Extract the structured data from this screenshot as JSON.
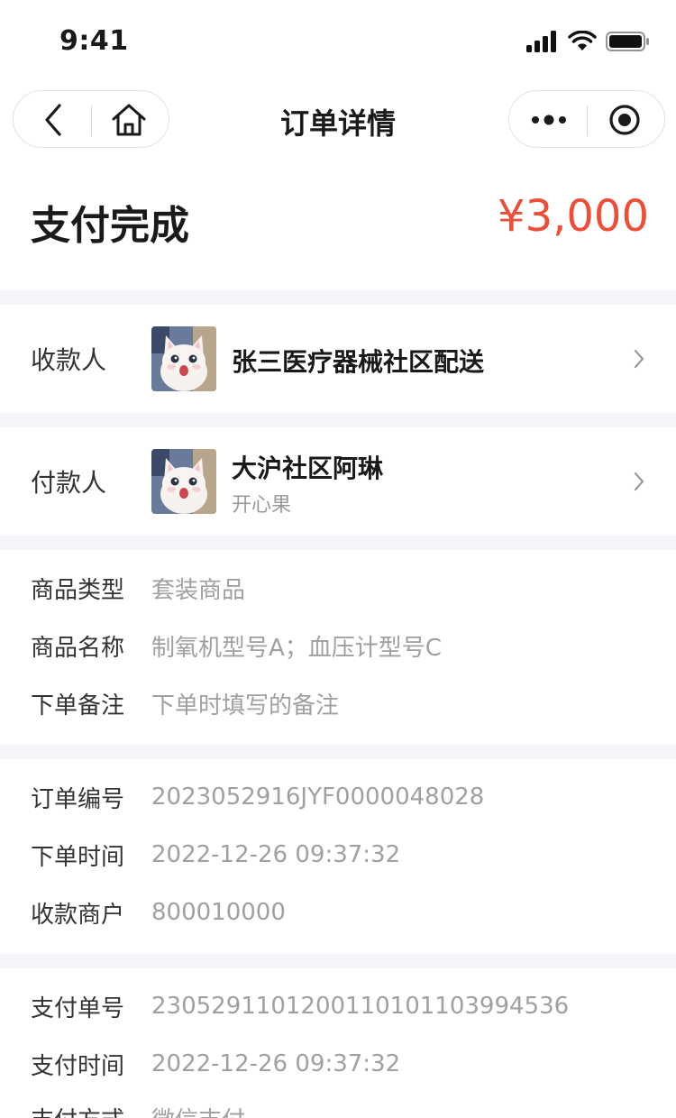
{
  "status_bar": {
    "time": "9:41"
  },
  "nav": {
    "title": "订单详情"
  },
  "header": {
    "status": "支付完成",
    "amount": "¥3,000"
  },
  "payee": {
    "label": "收款人",
    "name": "张三医疗器械社区配送"
  },
  "payer": {
    "label": "付款人",
    "name": "大沪社区阿琳",
    "sub": "开心果"
  },
  "product": [
    {
      "label": "商品类型",
      "value": "套装商品"
    },
    {
      "label": "商品名称",
      "value": "制氧机型号A；血压计型号C"
    },
    {
      "label": "下单备注",
      "value": "下单时填写的备注"
    }
  ],
  "order": [
    {
      "label": "订单编号",
      "value": "2023052916JYF0000048028"
    },
    {
      "label": "下单时间",
      "value": "2022-12-26 09:37:32"
    },
    {
      "label": "收款商户",
      "value": "800010000"
    }
  ],
  "payment": [
    {
      "label": "支付单号",
      "value": "2305291101200110101103994536"
    },
    {
      "label": "支付时间",
      "value": "2022-12-26 09:37:32"
    },
    {
      "label": "支付方式",
      "value": "微信支付"
    }
  ],
  "colors": {
    "accent": "#e8503a",
    "divider": "#f4f5f8",
    "muted": "#a0a0a0"
  }
}
